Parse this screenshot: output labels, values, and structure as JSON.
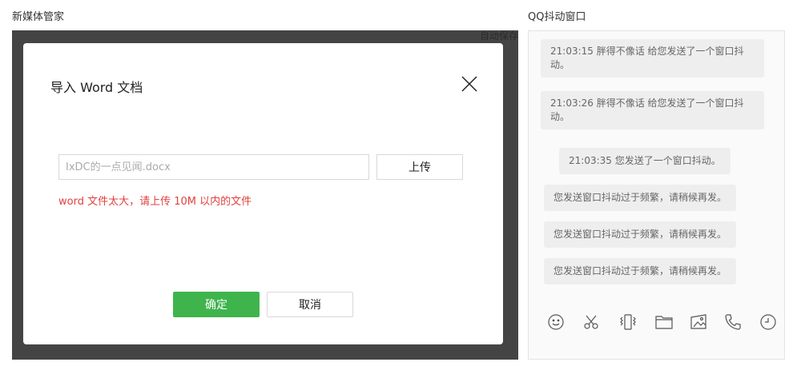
{
  "left_section": {
    "title": "新媒体管家",
    "autosave_label": "自动保存"
  },
  "dialog": {
    "title": "导入 Word 文档",
    "file_input": {
      "value": "",
      "placeholder": "IxDC的一点见闻.docx"
    },
    "upload_label": "上传",
    "error_message": "word 文件太大，请上传 10M 以内的文件",
    "confirm_label": "确定",
    "cancel_label": "取消"
  },
  "right_section": {
    "title": "QQ抖动窗口",
    "messages": [
      {
        "text": "21:03:15 胖得不像话 给您发送了一个窗口抖动。"
      },
      {
        "text": "21:03:26 胖得不像话 给您发送了一个窗口抖动。"
      },
      {
        "text": "21:03:35 您发送了一个窗口抖动。"
      },
      {
        "text": "您发送窗口抖动过于频繁，请稍候再发。"
      },
      {
        "text": "您发送窗口抖动过于频繁，请稍候再发。"
      },
      {
        "text": "您发送窗口抖动过于频繁，请稍候再发。"
      }
    ],
    "toolbar_icons": [
      "smiley-icon",
      "scissors-icon",
      "shake-icon",
      "folder-icon",
      "image-icon",
      "phone-icon",
      "clock-icon"
    ]
  },
  "colors": {
    "overlay": "#444444",
    "primary_green": "#3fb44d",
    "error_red": "#e0413f",
    "message_bg": "#eeeeee"
  }
}
